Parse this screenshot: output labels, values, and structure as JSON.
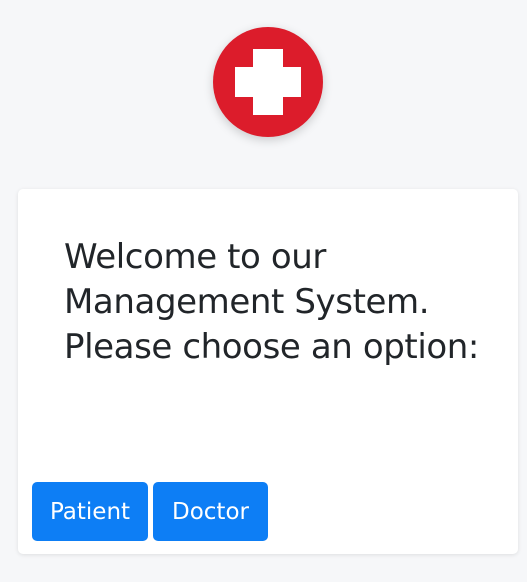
{
  "colors": {
    "background": "#f6f7f9",
    "logo_red": "#dc1c2b",
    "button_blue": "#0d7ef5",
    "heading_text": "#212529"
  },
  "logo": {
    "icon": "medical-cross-icon"
  },
  "card": {
    "heading": "Welcome to our Management System. Please choose an option:",
    "buttons": [
      {
        "label": "Patient"
      },
      {
        "label": "Doctor"
      }
    ]
  }
}
